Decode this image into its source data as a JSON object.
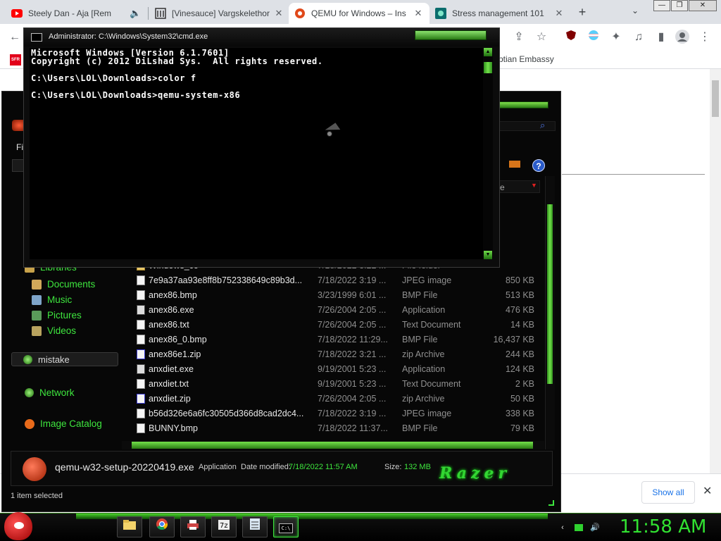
{
  "browser": {
    "tabs": [
      {
        "title": "Steely Dan - Aja [Rem",
        "favicon": "youtube-icon"
      },
      {
        "title": "[Vinesauce] Vargskelethor",
        "favicon": "archive-icon"
      },
      {
        "title": "QEMU for Windows – Ins",
        "favicon": "qemu-icon"
      },
      {
        "title": "Stress management 101",
        "favicon": "site-icon"
      }
    ],
    "new_tab": "+",
    "tab_search": "⌄",
    "window_controls": {
      "minimize": "—",
      "maximize": "❐",
      "close": "✕"
    }
  },
  "bookmarks": {
    "sfr": "SFR",
    "embassy": "ptian Embassy"
  },
  "download_bar": {
    "show_all": "Show all",
    "close": "✕"
  },
  "explorer": {
    "menu_fragment": "Fi",
    "sort_fragment": "e",
    "nav": {
      "libraries": "Libraries",
      "documents": "Documents",
      "music": "Music",
      "pictures": "Pictures",
      "videos": "Videos",
      "mistake": "mistake",
      "network": "Network",
      "image_catalog": "Image Catalog"
    },
    "files": [
      {
        "name": "Windows_co",
        "date": "7/18/2022 3:22 ...",
        "type": "File folder",
        "size": ""
      },
      {
        "name": "7e9a37aa93e8ff8b752338649c89b3d...",
        "date": "7/18/2022 3:19 ...",
        "type": "JPEG image",
        "size": "850 KB"
      },
      {
        "name": "anex86.bmp",
        "date": "3/23/1999 6:01 ...",
        "type": "BMP File",
        "size": "513 KB"
      },
      {
        "name": "anex86.exe",
        "date": "7/26/2004 2:05 ...",
        "type": "Application",
        "size": "476 KB"
      },
      {
        "name": "anex86.txt",
        "date": "7/26/2004 2:05 ...",
        "type": "Text Document",
        "size": "14 KB"
      },
      {
        "name": "anex86_0.bmp",
        "date": "7/18/2022 11:29...",
        "type": "BMP File",
        "size": "16,437 KB"
      },
      {
        "name": "anex86e1.zip",
        "date": "7/18/2022 3:21 ...",
        "type": "zip Archive",
        "size": "244 KB"
      },
      {
        "name": "anxdiet.exe",
        "date": "9/19/2001 5:23 ...",
        "type": "Application",
        "size": "124 KB"
      },
      {
        "name": "anxdiet.txt",
        "date": "9/19/2001 5:23 ...",
        "type": "Text Document",
        "size": "2 KB"
      },
      {
        "name": "anxdiet.zip",
        "date": "7/26/2004 2:05 ...",
        "type": "zip Archive",
        "size": "50 KB"
      },
      {
        "name": "b56d326e6a6fc30505d366d8cad2dc4...",
        "date": "7/18/2022 3:19 ...",
        "type": "JPEG image",
        "size": "338 KB"
      },
      {
        "name": "BUNNY.bmp",
        "date": "7/18/2022 11:37...",
        "type": "BMP File",
        "size": "79 KB"
      }
    ],
    "details": {
      "name": "qemu-w32-setup-20220419.exe",
      "type": "Application",
      "modified_label": "Date modified:",
      "modified_value": "7/18/2022 11:57 AM",
      "size_label": "Size:",
      "size_value": "132 MB",
      "logo": "Razer"
    },
    "status": "1 item selected",
    "help": "?"
  },
  "cmd": {
    "title": "Administrator: C:\\Windows\\System32\\cmd.exe",
    "lines": [
      "Microsoft Windows [Version 6.1.7601]",
      "Copyright (c) 2012 DiLshad Sys.  All rights reserved.",
      "",
      "C:\\Users\\LOL\\Downloads>color f",
      "",
      "C:\\Users\\LOL\\Downloads>qemu-system-x86"
    ]
  },
  "taskbar": {
    "clock": "11:58 AM",
    "cmd_label": "C:\\"
  },
  "colors": {
    "razer_green": "#3ee63e",
    "chrome_tab_bg": "#dee1e6",
    "link_blue": "#1a73e8"
  }
}
